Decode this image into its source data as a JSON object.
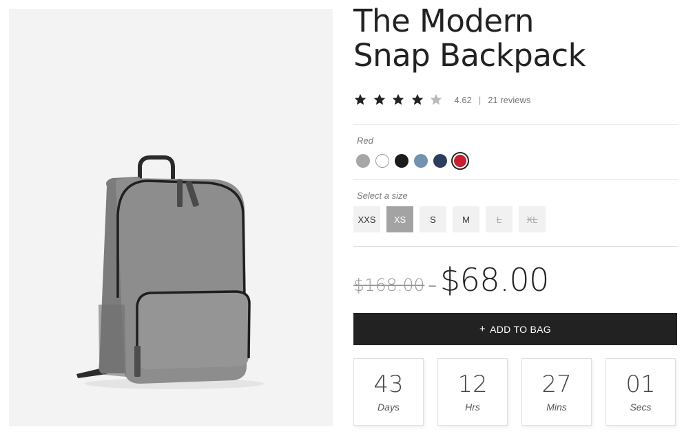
{
  "product": {
    "title_line1": "The Modern",
    "title_line2": "Snap Backpack"
  },
  "rating": {
    "value": "4.62",
    "separator": "|",
    "reviews_label": "21 reviews",
    "stars_filled": 4,
    "stars_total": 5
  },
  "color": {
    "selected_label": "Red",
    "swatches": [
      "#a6a6a6",
      "#ffffff",
      "#1c1c1c",
      "#7391b1",
      "#2c3e5e",
      "#c8202e"
    ],
    "selected_index": 5
  },
  "size": {
    "label": "Select a size",
    "options": [
      "XXS",
      "XS",
      "S",
      "M",
      "L",
      "XL"
    ],
    "selected": "XS",
    "unavailable": [
      "L",
      "XL"
    ]
  },
  "price": {
    "old": "$168.00",
    "dash": "–",
    "current": "$68.00"
  },
  "cart": {
    "plus": "+",
    "add_label": "ADD TO BAG"
  },
  "countdown": {
    "days": "43",
    "days_label": "Days",
    "hours": "12",
    "hours_label": "Hrs",
    "mins": "27",
    "mins_label": "Mins",
    "secs": "01",
    "secs_label": "Secs"
  }
}
